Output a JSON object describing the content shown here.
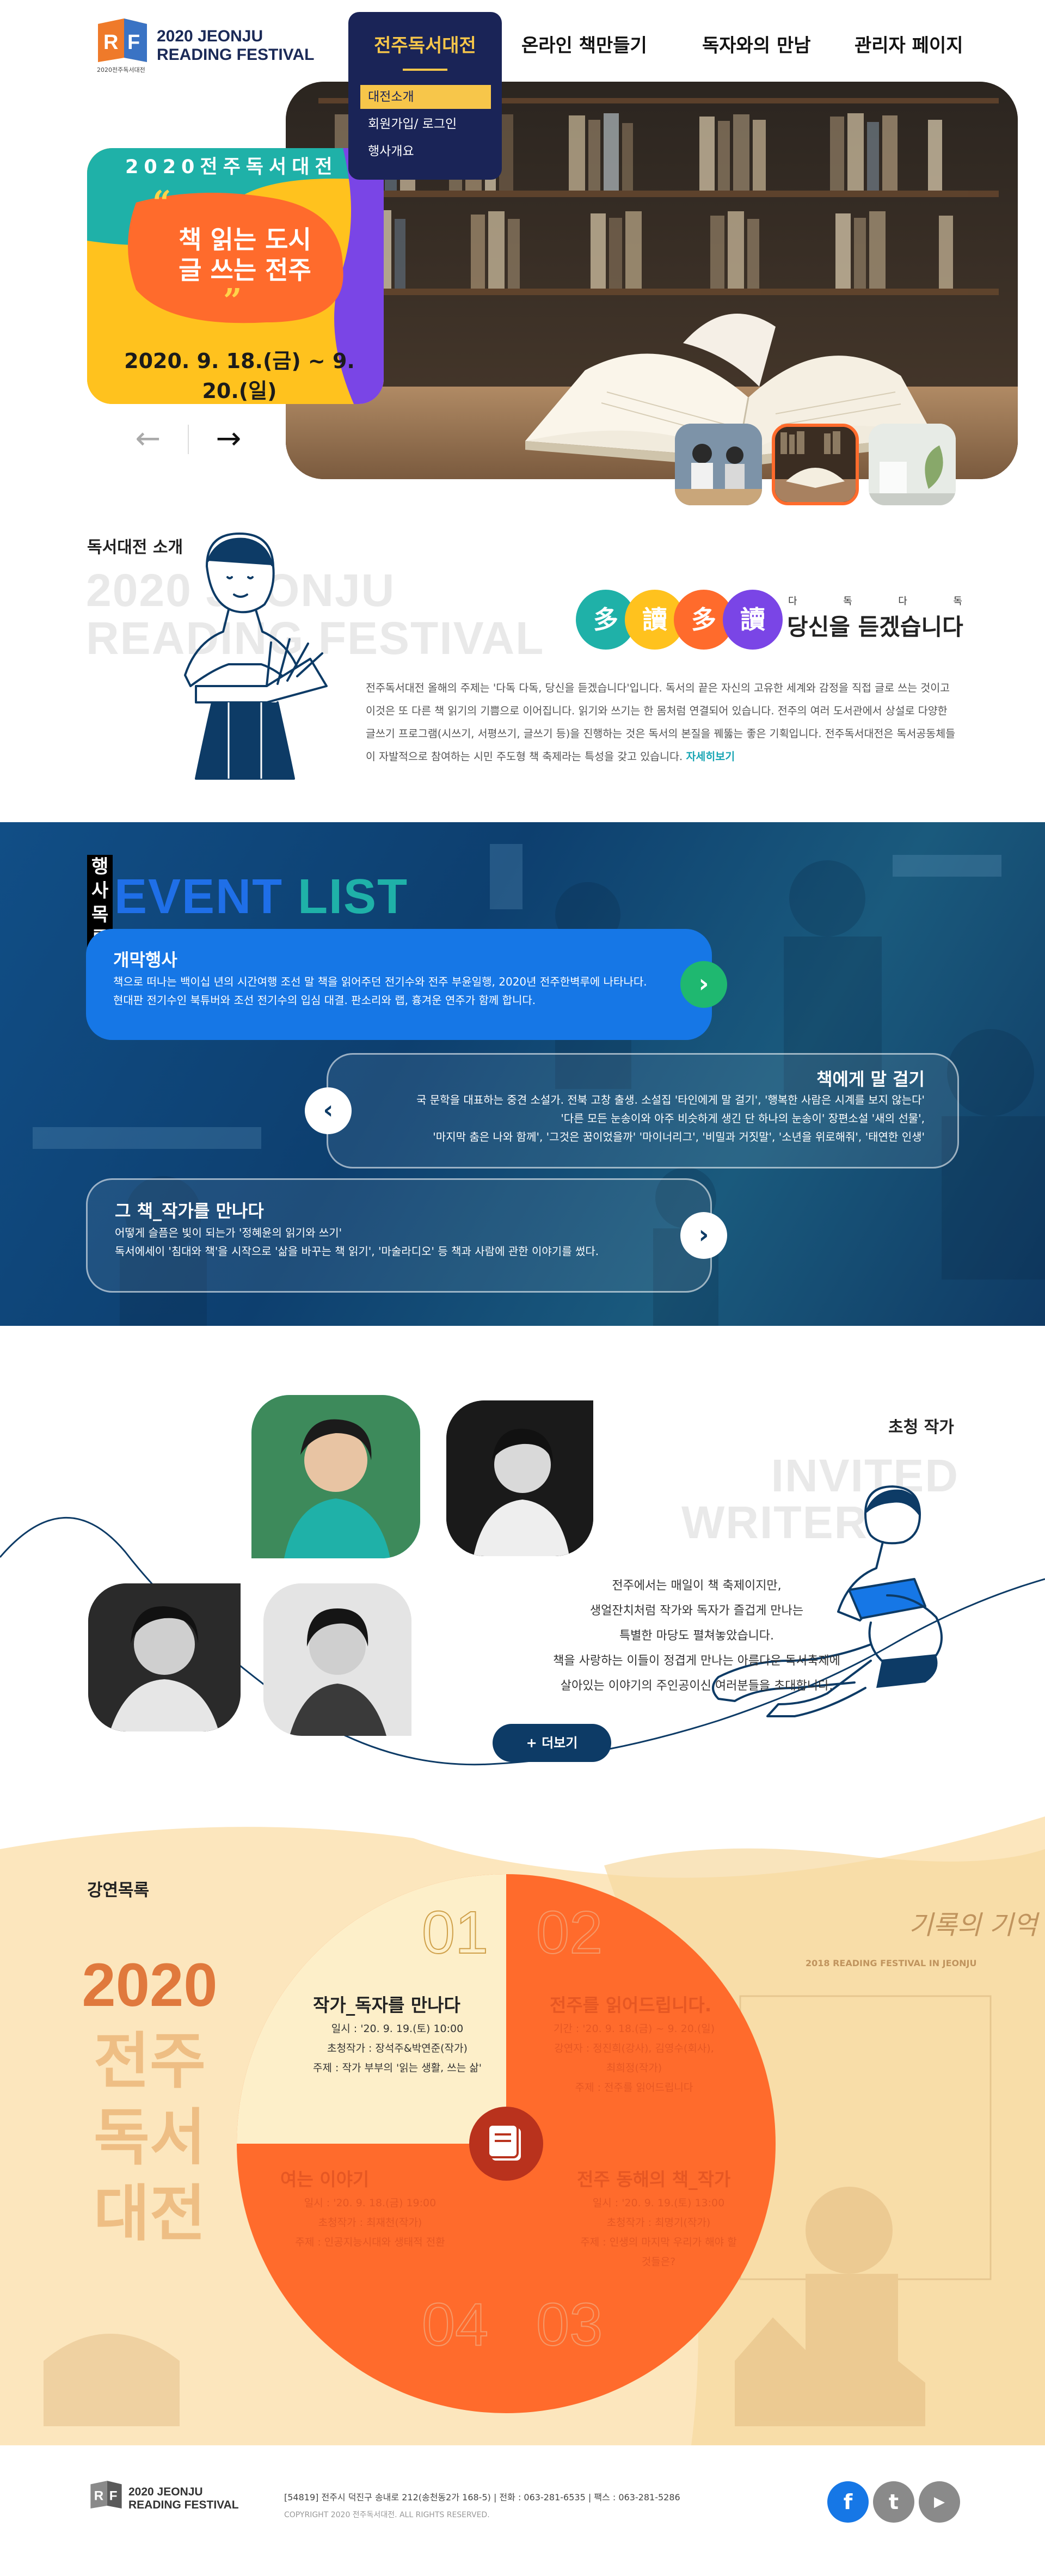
{
  "header": {
    "logo_line1": "2020 JEONJU",
    "logo_line2": "READING FESTIVAL",
    "logo_badge": "RF",
    "logo_small": "2020전주독서대전",
    "nav": [
      {
        "label": "전주독서대전",
        "active": true
      },
      {
        "label": "온라인 책만들기"
      },
      {
        "label": "독자와의 만남"
      },
      {
        "label": "관리자 페이지"
      }
    ],
    "submenu": [
      "대전소개",
      "회원가입/ 로그인",
      "행사개요"
    ]
  },
  "hero": {
    "kicker": "2020전주독서대전",
    "title_line1": "책 읽는 도시",
    "title_line2": "글 쓰는 전주",
    "open_quote": "“",
    "close_quote": "”",
    "date": "2020. 9. 18.(금) ~ 9. 20.(일)",
    "prev_icon": "←",
    "next_icon": "→"
  },
  "intro": {
    "section_title": "독서대전 소개",
    "ghost_line1": "2020 JEONJU",
    "ghost_line2": "READING FESTIVAL",
    "badges": [
      "多",
      "讀",
      "多",
      "讀"
    ],
    "ruby": [
      "다",
      "독",
      "다",
      "독"
    ],
    "tagline": "당신을 듣겠습니다",
    "body": "전주독서대전 올해의 주제는 '다독 다독, 당신을 듣겠습니다'입니다. 독서의 끝은 자신의 고유한 세계와 감정을 직접 글로 쓰는 것이고 이것은 또 다른 책 읽기의 기쁨으로 이어집니다. 읽기와 쓰기는 한 몸처럼 연결되어 있습니다. 전주의 여러 도서관에서 상설로 다양한 글쓰기 프로그램(시쓰기, 서평쓰기, 글쓰기 등)을 진행하는 것은 독서의 본질을 꿰뚫는 좋은 기획입니다. 전주독서대전은 독서공동체들이 자발적으로 참여하는 시민 주도형 책 축제라는 특성을 갖고 있습니다.",
    "more": "자세히보기"
  },
  "events": {
    "heading_kr": "행사 목록",
    "heading_en_1": "EVENT",
    "heading_en_2": "LIST",
    "items": [
      {
        "title": "개막행사",
        "line1": "책으로 떠나는 백이십 년의 시간여행 조선 말 책을 읽어주던 전기수와 전주 부윤일행, 2020년 전주한벽루에 나타나다.",
        "line2": "현대판 전기수인 북튜버와 조선 전기수의 입심 대결. 판소리와 랩, 흉겨운 연주가 함께 합니다.",
        "button_icon": "›"
      },
      {
        "title": "책에게 말 걸기",
        "line1": "국 문학을 대표하는 중견 소설가. 전북 고창 출생. 소설집 '타인에게 말 걸기', '행복한 사람은 시계를 보지 않는다'",
        "line2": "'다른 모든 눈송이와 아주 비슷하게 생긴 단 하나의 눈송이' 장편소설 '새의 선물',",
        "line3": "'마지막 춤은 나와 함께', '그것은 꿈이었을까' '마이너리그', '비밀과 거짓말', '소년을 위로해줘', '태연한 인생'",
        "button_icon": "‹"
      },
      {
        "title": "그 책_작가를 만나다",
        "line1": "어떻게 슬픔은 빛이 되는가 '정혜윤의 읽기와 쓰기'",
        "line2": "독서에세이 '침대와 책'을 시작으로 '삶을 바꾸는 책 읽기', '마술라디오' 등 책과 사람에 관한 이야기를 썼다.",
        "button_icon": "›"
      }
    ]
  },
  "writers": {
    "section_title": "초청 작가",
    "ghost_line1": "INVITED",
    "ghost_line2": "WRITER",
    "text_lines": [
      "전주에서는 매일이 책 축제이지만,",
      "생얼잔치처럼 작가와 독자가 즐겁게 만나는",
      "특별한 마당도 펼쳐놓았습니다.",
      "책을 사랑하는 이들이 정겹게 만나는 아름다운 독서축제에",
      "살아있는 이야기의 주인공이신 여러분들을 초대합니다."
    ],
    "more": "+ 더보기"
  },
  "lectures": {
    "section_title": "강연목록",
    "big_year": "2020",
    "big_kr": [
      "전주",
      "독서",
      "대전"
    ],
    "bg_caption": "2018 READING FESTIVAL IN JEONJU",
    "bg_script": "기록의 기억",
    "items": [
      {
        "num": "01",
        "title": "작가_독자를 만나다",
        "date": "일시 : '20. 9. 19.(토) 10:00",
        "speaker": "초청작가 : 장석주&박연준(작가)",
        "topic": "주제 : 작가 부부의 '읽는 생활, 쓰는 삶'"
      },
      {
        "num": "02",
        "title": "전주를 읽어드립니다.",
        "date": "기간 : '20. 9. 18.(금) ~ 9. 20.(일)",
        "speaker": "강연자 : 정진희(강사), 김영수(회사),",
        "speaker2": "최희정(작가)",
        "topic": "주제 : 전주를 읽어드립니다"
      },
      {
        "num": "03",
        "title": "전주 동해의 책_작가",
        "date": "일시 : '20. 9. 19.(토) 13:00",
        "speaker": "초청작가 : 최명기(작가)",
        "topic": "주제 : 인생의 마지막 우리가 해야 할",
        "topic2": "것들은?"
      },
      {
        "num": "04",
        "title": "여는 이야기",
        "date": "일시 : '20. 9. 18.(금) 19:00",
        "speaker": "초청작가 : 최재천(작가)",
        "topic": "주제 : 인공지능시대와 생태적 전환"
      }
    ]
  },
  "footer": {
    "logo_line1": "2020 JEONJU",
    "logo_line2": "READING FESTIVAL",
    "address": "[54819] 전주시 덕진구 송내로 212(송천동2가 168-5) | 전화 : 063-281-6535 | 팩스 : 063-281-5286",
    "copyright": "COPYRIGHT 2020 전주독서대전. ALL RIGHTS RESERVED.",
    "social": [
      "f",
      "t",
      "▶"
    ]
  },
  "colors": {
    "navy": "#1a2457",
    "gold": "#f7c64a",
    "orange": "#ff6b2c",
    "teal": "#1fb1a8",
    "purple": "#7a45e6",
    "cream": "#fce8c4"
  }
}
